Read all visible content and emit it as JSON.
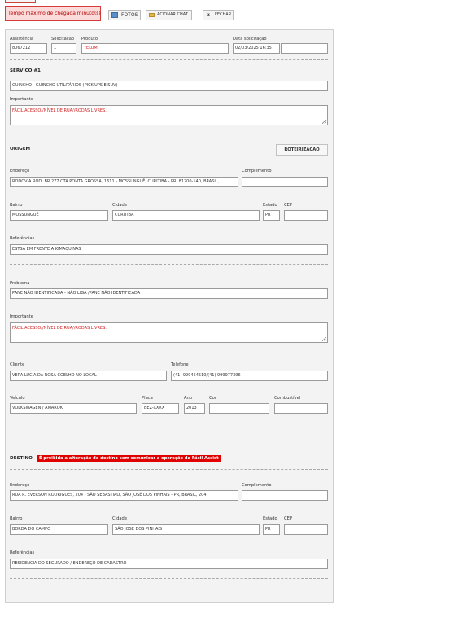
{
  "toolbar": {
    "alert_text": "Tempo máximo de chegada minuto(s)",
    "photos_label": "FOTOS",
    "chat_label": "ACIONAR CHAT",
    "close_glyph": "x",
    "close_label": "FECHAR"
  },
  "header": {
    "assistencia_label": "Assistência",
    "assistencia_value": "8067212",
    "solicitacao_label": "Solicitação",
    "solicitacao_value": "1",
    "produto_label": "Produto",
    "produto_value": "YELUM",
    "data_label": "Data solicitação",
    "data_value": "02/03/2025 16:35",
    "data_extra_value": ""
  },
  "servico": {
    "title": "SERVIÇO #1",
    "service_value": "GUINCHO - GUINCHO UTILITÁRIOS (PICK-UPS E SUV)",
    "importante_label": "Importante",
    "importante_value": "FÁCIL ACESSO//NÍVEL DE RUA//RODAS LIVRES."
  },
  "origem": {
    "title": "ORIGEM",
    "route_button": "ROTEIRIZAÇÃO",
    "endereco_label": "Endereço",
    "endereco_value": "RODOVIA ROD. BR 277 CTA PONTA GROSSA, 1611 - MOSSUNGUÊ, CURITIBA - PR, 81200-140, BRASIL,",
    "complemento_label": "Complemento",
    "complemento_value": "",
    "bairro_label": "Bairro",
    "bairro_value": "MOSSUNGUÊ",
    "cidade_label": "Cidade",
    "cidade_value": "CURITIBA",
    "estado_label": "Estado",
    "estado_value": "PR",
    "cep_label": "CEP",
    "cep_value": "",
    "referencias_label": "Referências",
    "referencias_value": "ESTSÁ EM FRENTE A KIMAQUINAS"
  },
  "problema": {
    "problema_label": "Problema",
    "problema_value": "PANE NÃO IDENTIFICADA - NÃO LIGA /PANE NÃO IDENTIFICADA",
    "importante_label": "Importante",
    "importante_value": "FÁCIL ACESSO//NÍVEL DE RUA//RODAS LIVRES.",
    "cliente_label": "Cliente",
    "cliente_value": "VERA LUCIA DA ROSA COELHO  NO LOCAL",
    "telefone_label": "Telefone",
    "telefone_value": "(41) 999454510/(41) 999977396",
    "veiculo_label": "Veículo",
    "veiculo_value": "VOLKSWAGEN / AMAROK",
    "placa_label": "Placa",
    "placa_value": "BEZ-XXXX",
    "ano_label": "Ano",
    "ano_value": "2013",
    "cor_label": "Cor",
    "cor_value": "",
    "combustivel_label": "Combustível",
    "combustivel_value": ""
  },
  "destino": {
    "title": "DESTINO",
    "warning": "É proibida a alteração de destino sem comunicar a operação da Fácil Assist",
    "endereco_label": "Endereço",
    "endereco_value": "RUA R. EVERSON RODRIGUES, 204 - SÃO SEBASTIAO, SÃO JOSÉ DOS PINHAIS - PR, BRASIL, 204",
    "complemento_label": "Complemento",
    "complemento_value": "",
    "bairro_label": "Bairro",
    "bairro_value": "BORDA DO CAMPO",
    "cidade_label": "Cidade",
    "cidade_value": "SÃO JOSÉ DOS PINHAIS",
    "estado_label": "Estado",
    "estado_value": "PR",
    "cep_label": "CEP",
    "cep_value": "",
    "referencias_label": "Referências",
    "referencias_value": "RESIDENCIA DO SEGURADO / ENDEREÇO DE CADASTRO"
  },
  "colors": {
    "alert_bg": "#fbdada",
    "alert_border": "#d53b3b",
    "warning_red": "#e00000",
    "value_red": "#d11e1e",
    "panel_bg": "#f3f3f3"
  },
  "icons": [
    "photo-icon",
    "chat-icon",
    "close-icon"
  ]
}
